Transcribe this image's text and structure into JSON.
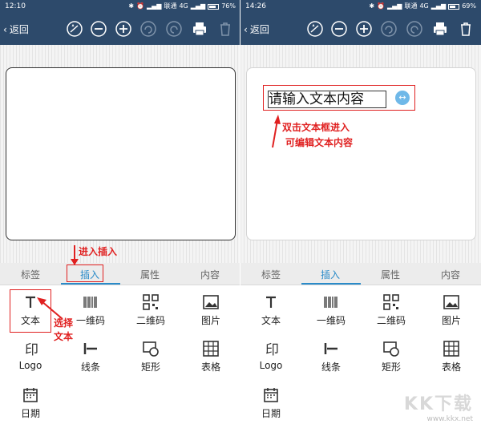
{
  "left": {
    "status": {
      "time": "12:10",
      "carrier": "联通",
      "network": "4G",
      "battery": "76%",
      "battery_level": 0.76
    },
    "toolbar": {
      "back_label": "返回"
    },
    "tabs": [
      "标签",
      "插入",
      "属性",
      "内容"
    ],
    "active_tab": 1,
    "insert_items": [
      "文本",
      "一维码",
      "二维码",
      "图片",
      "Logo",
      "线条",
      "矩形",
      "表格",
      "日期"
    ],
    "annotations": {
      "enter_insert": "进入插入",
      "select_text_line1": "选择",
      "select_text_line2": "文本"
    }
  },
  "right": {
    "status": {
      "time": "14:26",
      "carrier": "联通",
      "network": "4G",
      "battery": "69%",
      "battery_level": 0.69
    },
    "toolbar": {
      "back_label": "返回"
    },
    "tabs": [
      "标签",
      "插入",
      "属性",
      "内容"
    ],
    "active_tab": 1,
    "insert_items": [
      "文本",
      "一维码",
      "二维码",
      "图片",
      "Logo",
      "线条",
      "矩形",
      "表格",
      "日期"
    ],
    "textbox_placeholder": "请输入文本内容",
    "annotations": {
      "edit_line1": "双击文本框进入",
      "edit_line2": "可编辑文本内容"
    }
  },
  "watermark": {
    "brand": "KK下载",
    "url": "www.kkx.net"
  },
  "colors": {
    "header": "#2d4a6b",
    "accent": "#2a8bc9",
    "annotation": "#e02020"
  }
}
